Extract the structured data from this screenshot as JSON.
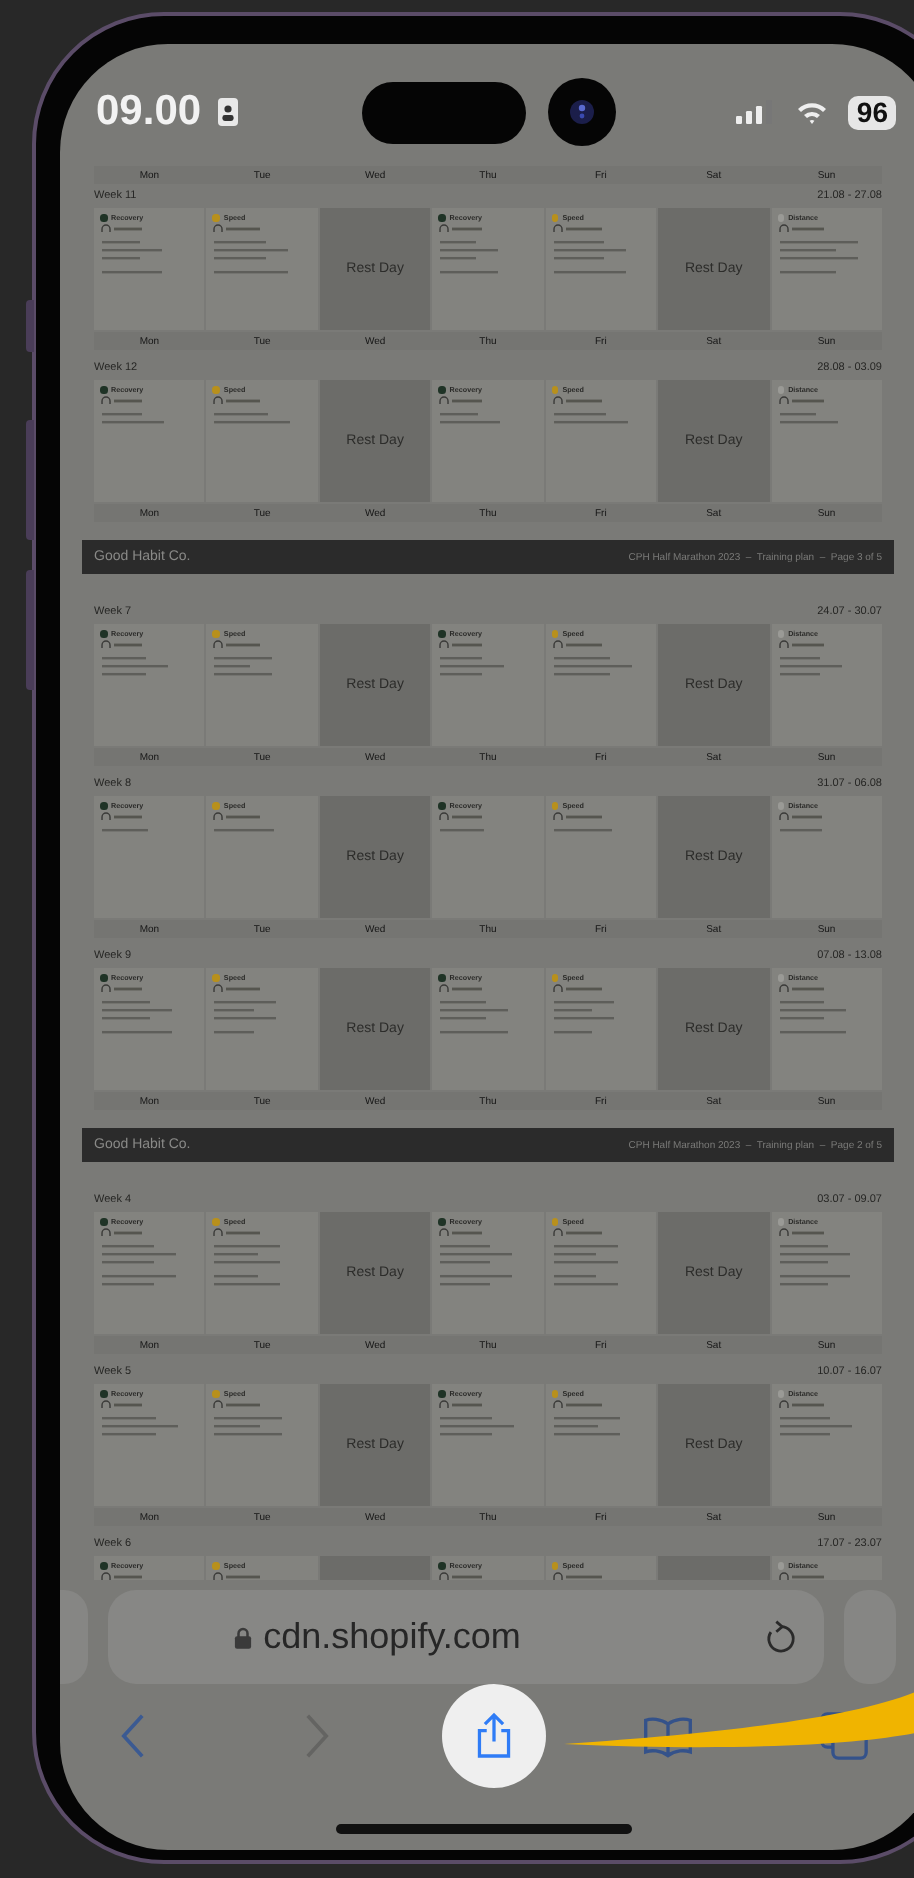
{
  "status_bar": {
    "time": "09.00",
    "battery": "96"
  },
  "document": [
    {
      "kind": "day_labels",
      "labels": [
        "Mon",
        "Tue",
        "Wed",
        "Thu",
        "Fri",
        "Sat",
        "Sun"
      ]
    },
    {
      "kind": "week",
      "label": "Week 11",
      "dates": "21.08 - 27.08",
      "days": [
        {
          "kind": "session",
          "category": "Recovery",
          "color": "#1f3326"
        },
        {
          "kind": "session",
          "category": "Speed",
          "color": "#b8901c"
        },
        {
          "kind": "rest",
          "label": "Rest Day"
        },
        {
          "kind": "session",
          "category": "Recovery",
          "color": "#1f3326"
        },
        {
          "kind": "session",
          "category": "Speed",
          "color": "#b8901c"
        },
        {
          "kind": "rest",
          "label": "Rest Day"
        },
        {
          "kind": "session",
          "category": "Distance",
          "color": "#9a9a96"
        }
      ],
      "day_labels": [
        "Mon",
        "Tue",
        "Wed",
        "Thu",
        "Fri",
        "Sat",
        "Sun"
      ]
    },
    {
      "kind": "week",
      "label": "Week 12",
      "dates": "28.08 - 03.09",
      "days": [
        {
          "kind": "session",
          "category": "Recovery",
          "color": "#1f3326"
        },
        {
          "kind": "session",
          "category": "Speed",
          "color": "#b8901c"
        },
        {
          "kind": "rest",
          "label": "Rest Day"
        },
        {
          "kind": "session",
          "category": "Recovery",
          "color": "#1f3326"
        },
        {
          "kind": "session",
          "category": "Speed",
          "color": "#b8901c"
        },
        {
          "kind": "rest",
          "label": "Rest Day"
        },
        {
          "kind": "session",
          "category": "Distance",
          "color": "#9a9a96"
        }
      ],
      "day_labels": [
        "Mon",
        "Tue",
        "Wed",
        "Thu",
        "Fri",
        "Sat",
        "Sun"
      ]
    },
    {
      "kind": "page_header",
      "brand": "Good Habit Co.",
      "title": "CPH Half Marathon 2023  –  Training plan  –  Page 3 of 5"
    },
    {
      "kind": "week",
      "label": "Week 7",
      "dates": "24.07 - 30.07",
      "days": [
        {
          "kind": "session",
          "category": "Recovery",
          "color": "#1f3326"
        },
        {
          "kind": "session",
          "category": "Speed",
          "color": "#b8901c"
        },
        {
          "kind": "rest",
          "label": "Rest Day"
        },
        {
          "kind": "session",
          "category": "Recovery",
          "color": "#1f3326"
        },
        {
          "kind": "session",
          "category": "Speed",
          "color": "#b8901c"
        },
        {
          "kind": "rest",
          "label": "Rest Day"
        },
        {
          "kind": "session",
          "category": "Distance",
          "color": "#9a9a96"
        }
      ],
      "day_labels": [
        "Mon",
        "Tue",
        "Wed",
        "Thu",
        "Fri",
        "Sat",
        "Sun"
      ]
    },
    {
      "kind": "week",
      "label": "Week 8",
      "dates": "31.07 - 06.08",
      "days": [
        {
          "kind": "session",
          "category": "Recovery",
          "color": "#1f3326"
        },
        {
          "kind": "session",
          "category": "Speed",
          "color": "#b8901c"
        },
        {
          "kind": "rest",
          "label": "Rest Day"
        },
        {
          "kind": "session",
          "category": "Recovery",
          "color": "#1f3326"
        },
        {
          "kind": "session",
          "category": "Speed",
          "color": "#b8901c"
        },
        {
          "kind": "rest",
          "label": "Rest Day"
        },
        {
          "kind": "session",
          "category": "Distance",
          "color": "#9a9a96"
        }
      ],
      "day_labels": [
        "Mon",
        "Tue",
        "Wed",
        "Thu",
        "Fri",
        "Sat",
        "Sun"
      ]
    },
    {
      "kind": "week",
      "label": "Week 9",
      "dates": "07.08 - 13.08",
      "days": [
        {
          "kind": "session",
          "category": "Recovery",
          "color": "#1f3326"
        },
        {
          "kind": "session",
          "category": "Speed",
          "color": "#b8901c"
        },
        {
          "kind": "rest",
          "label": "Rest Day"
        },
        {
          "kind": "session",
          "category": "Recovery",
          "color": "#1f3326"
        },
        {
          "kind": "session",
          "category": "Speed",
          "color": "#b8901c"
        },
        {
          "kind": "rest",
          "label": "Rest Day"
        },
        {
          "kind": "session",
          "category": "Distance",
          "color": "#9a9a96"
        }
      ],
      "day_labels": [
        "Mon",
        "Tue",
        "Wed",
        "Thu",
        "Fri",
        "Sat",
        "Sun"
      ]
    },
    {
      "kind": "page_header",
      "brand": "Good Habit Co.",
      "title": "CPH Half Marathon 2023  –  Training plan  –  Page 2 of 5"
    },
    {
      "kind": "week",
      "label": "Week 4",
      "dates": "03.07 - 09.07",
      "days": [
        {
          "kind": "session",
          "category": "Recovery",
          "color": "#1f3326"
        },
        {
          "kind": "session",
          "category": "Speed",
          "color": "#b8901c"
        },
        {
          "kind": "rest",
          "label": "Rest Day"
        },
        {
          "kind": "session",
          "category": "Recovery",
          "color": "#1f3326"
        },
        {
          "kind": "session",
          "category": "Speed",
          "color": "#b8901c"
        },
        {
          "kind": "rest",
          "label": "Rest Day"
        },
        {
          "kind": "session",
          "category": "Distance",
          "color": "#9a9a96"
        }
      ],
      "day_labels": [
        "Mon",
        "Tue",
        "Wed",
        "Thu",
        "Fri",
        "Sat",
        "Sun"
      ]
    },
    {
      "kind": "week",
      "label": "Week 5",
      "dates": "10.07 - 16.07",
      "days": [
        {
          "kind": "session",
          "category": "Recovery",
          "color": "#1f3326"
        },
        {
          "kind": "session",
          "category": "Speed",
          "color": "#b8901c"
        },
        {
          "kind": "rest",
          "label": "Rest Day"
        },
        {
          "kind": "session",
          "category": "Recovery",
          "color": "#1f3326"
        },
        {
          "kind": "session",
          "category": "Speed",
          "color": "#b8901c"
        },
        {
          "kind": "rest",
          "label": "Rest Day"
        },
        {
          "kind": "session",
          "category": "Distance",
          "color": "#9a9a96"
        }
      ],
      "day_labels": [
        "Mon",
        "Tue",
        "Wed",
        "Thu",
        "Fri",
        "Sat",
        "Sun"
      ]
    },
    {
      "kind": "week",
      "label": "Week 6",
      "dates": "17.07 - 23.07",
      "days": [
        {
          "kind": "session",
          "category": "Recovery",
          "color": "#1f3326"
        },
        {
          "kind": "session",
          "category": "Speed",
          "color": "#b8901c"
        },
        {
          "kind": "rest"
        },
        {
          "kind": "session",
          "category": "Recovery",
          "color": "#1f3326"
        },
        {
          "kind": "session",
          "category": "Speed",
          "color": "#b8901c"
        },
        {
          "kind": "rest"
        },
        {
          "kind": "session",
          "category": "Distance",
          "color": "#9a9a96"
        }
      ]
    }
  ],
  "browser": {
    "url": "cdn.shopify.com"
  }
}
